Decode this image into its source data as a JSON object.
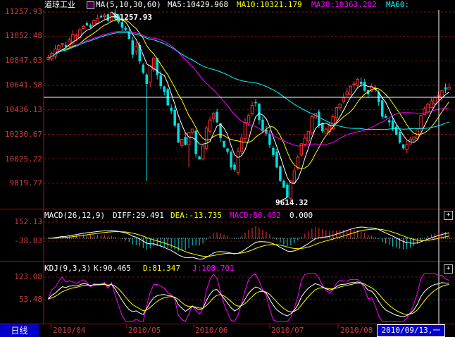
{
  "main_panel": {
    "stock_name": "道琼工业",
    "ma_prefix": "MA(5,10,30,60)",
    "ma5": "MA5:10429.968",
    "ma10": "MA10:10321.179",
    "ma30": "MA30:10363.202",
    "ma60": "MA60:",
    "high_label": "11257.93",
    "low_label": "9614.32",
    "y_ticks": [
      "11257.93",
      "11052.48",
      "10847.03",
      "10641.58",
      "10436.13",
      "10230.67",
      "10025.22",
      "9819.77"
    ]
  },
  "macd_panel": {
    "title": "MACD(26,12,9)",
    "diff": "DIFF:29.491",
    "dea": "DEA:-13.735",
    "macd": "MACD:86.452",
    "extra": "0.000",
    "y_ticks": [
      "152.13",
      "-38.83"
    ]
  },
  "kdj_panel": {
    "title": "KDJ(9,3,3)",
    "k": "K:90.465",
    "d": "D:81.347",
    "j": "J:108.701",
    "y_ticks": [
      "123.08",
      "53.48"
    ]
  },
  "bottom_bar": {
    "period_tab": "日线",
    "months": [
      "2010/04",
      "2010/05",
      "2010/06",
      "2010/07",
      "2010/08"
    ],
    "cursor_date": "2010/09/13,一"
  },
  "colors": {
    "up": "#ff3232",
    "down": "#00e0e0",
    "ma5": "#ffffff",
    "ma10": "#ffff00",
    "ma30": "#ff00ff",
    "ma60": "#00ffff",
    "axis": "#d03b3b"
  },
  "chart_data": {
    "type": "candlestick",
    "title": "道琼工业",
    "ylim": [
      9614.32,
      11257.93
    ],
    "series": [
      {
        "name": "MA5",
        "last": 10429.968
      },
      {
        "name": "MA10",
        "last": 10321.179
      },
      {
        "name": "MA30",
        "last": 10363.202
      },
      {
        "name": "MA60"
      }
    ],
    "annotations": [
      {
        "text": "11257.93",
        "kind": "high"
      },
      {
        "text": "9614.32",
        "kind": "low"
      }
    ],
    "candles_close": [
      10856,
      10890,
      10930,
      10960,
      10980,
      10950,
      11010,
      11060,
      11050,
      11100,
      11130,
      11140,
      11120,
      11180,
      11200,
      11210,
      11230,
      11180,
      11258,
      11200,
      11170,
      11120,
      11100,
      11020,
      10880,
      10950,
      10820,
      10720,
      10620,
      10780,
      10850,
      10700,
      10600,
      10550,
      10430,
      10380,
      10250,
      10100,
      10130,
      10080,
      10190,
      10220,
      10000,
      9950,
      10070,
      10230,
      10300,
      10360,
      10280,
      10140,
      10060,
      10020,
      9880,
      9860,
      10020,
      10140,
      10280,
      10340,
      10430,
      10450,
      10300,
      10200,
      10180,
      10080,
      9990,
      9880,
      9760,
      9700,
      9614,
      9760,
      9850,
      9970,
      10090,
      10140,
      10200,
      10330,
      10360,
      10250,
      10200,
      10220,
      10250,
      10330,
      10410,
      10440,
      10500,
      10550,
      10600,
      10620,
      10660,
      10620,
      10560,
      10530,
      10600,
      10570,
      10460,
      10330,
      10320,
      10280,
      10220,
      10170,
      10100,
      10050,
      10080,
      10130,
      10150,
      10220,
      10340,
      10400,
      10440,
      10470,
      10500,
      10520,
      10560,
      10570,
      10590
    ]
  }
}
